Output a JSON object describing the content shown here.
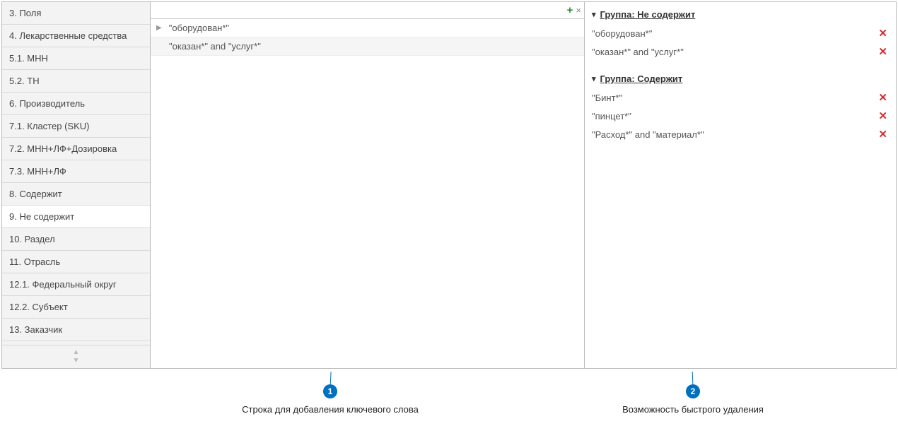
{
  "sidebar": {
    "items": [
      {
        "label": "3. Поля",
        "active": false
      },
      {
        "label": "4. Лекарственные средства",
        "active": false
      },
      {
        "label": "5.1. МНН",
        "active": false
      },
      {
        "label": "5.2. ТН",
        "active": false
      },
      {
        "label": "6. Производитель",
        "active": false
      },
      {
        "label": "7.1. Кластер (SKU)",
        "active": false
      },
      {
        "label": "7.2. МНН+ЛФ+Дозировка",
        "active": false
      },
      {
        "label": "7.3. МНН+ЛФ",
        "active": false
      },
      {
        "label": "8. Содержит",
        "active": false
      },
      {
        "label": "9. Не содержит",
        "active": true
      },
      {
        "label": "10. Раздел",
        "active": false
      },
      {
        "label": "11. Отрасль",
        "active": false
      },
      {
        "label": "12.1. Федеральный округ",
        "active": false
      },
      {
        "label": "12.2. Субъект",
        "active": false
      },
      {
        "label": "13. Заказчик",
        "active": false
      }
    ]
  },
  "center": {
    "rows": [
      {
        "text": "\"оборудован*\"",
        "expandable": true
      },
      {
        "text": "\"оказан*\" and \"услуг*\"",
        "expandable": false
      }
    ]
  },
  "right": {
    "groups": [
      {
        "title": "Группа: Не содержит",
        "items": [
          "\"оборудован*\"",
          "\"оказан*\" and \"услуг*\""
        ]
      },
      {
        "title": "Группа: Содержит",
        "items": [
          "\"Бинт*\"",
          "\"пинцет*\"",
          "\"Расход*\" and \"материал*\""
        ]
      }
    ]
  },
  "annotations": {
    "a1": {
      "num": "1",
      "label": "Строка для добавления ключевого слова"
    },
    "a2": {
      "num": "2",
      "label": "Возможность быстрого удаления"
    }
  }
}
